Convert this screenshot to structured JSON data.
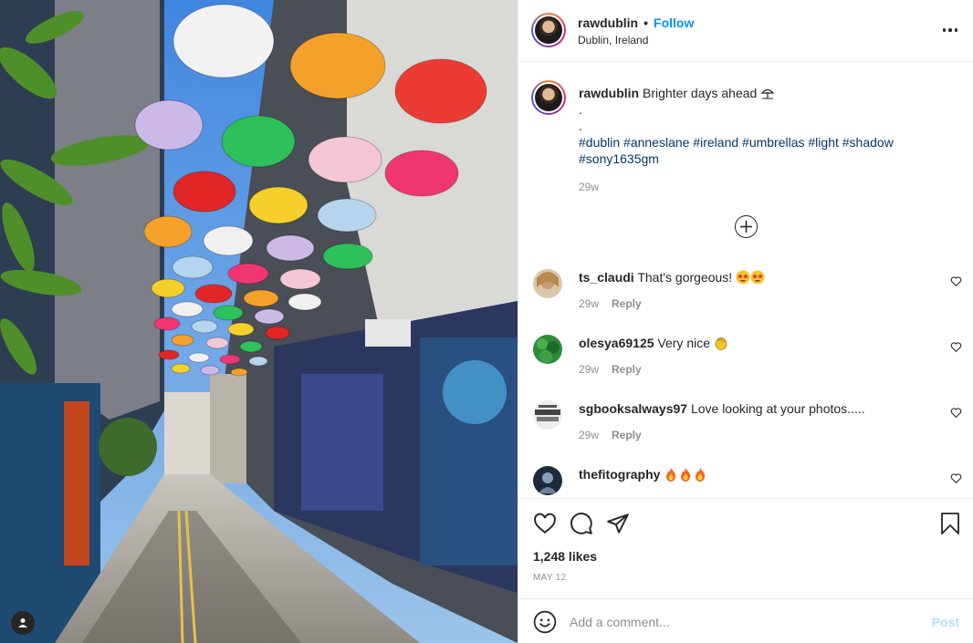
{
  "post": {
    "username": "rawdublin",
    "separator": "•",
    "follow_label": "Follow",
    "location": "Dublin, Ireland",
    "caption": {
      "username": "rawdublin",
      "text": "Brighter days ahead",
      "line2": ".",
      "line3": ".",
      "hashtags_line1": "#dublin #anneslane #ireland #umbrellas #light #shadow",
      "hashtags_line2": "#sony1635gm",
      "time": "29w"
    },
    "comments": [
      {
        "username": "ts_claudi",
        "text": "That's gorgeous!",
        "emojis": "star-struck-x2",
        "time": "29w",
        "reply_label": "Reply",
        "avatar_color": "#c9a37a"
      },
      {
        "username": "olesya69125",
        "text": "Very nice",
        "emojis": "clapping-hands",
        "time": "29w",
        "reply_label": "Reply",
        "avatar_color": "#2e8b3a"
      },
      {
        "username": "sgbooksalways97",
        "text": "Love looking at your photos.....",
        "emojis": "",
        "time": "29w",
        "reply_label": "Reply",
        "avatar_color": "#5a5a5a"
      },
      {
        "username": "thefitography",
        "text": "",
        "emojis": "fire-x3",
        "time": "",
        "reply_label": "",
        "avatar_color": "#1d2a3c"
      }
    ],
    "likes": "1,248 likes",
    "date": "MAY 12",
    "add_comment_placeholder": "Add a comment...",
    "post_button": "Post"
  },
  "icons": {
    "more": "more-options-icon",
    "load_more": "plus-circle-icon",
    "like": "heart-icon",
    "comment": "comment-bubble-icon",
    "share": "paper-plane-icon",
    "save": "bookmark-icon",
    "emoji": "smiley-icon",
    "tag": "user-tag-icon"
  },
  "colors": {
    "accent": "#0095f6",
    "hashtag": "#00376b",
    "muted": "#8e8e8e",
    "post_disabled": "#b2dffc"
  }
}
